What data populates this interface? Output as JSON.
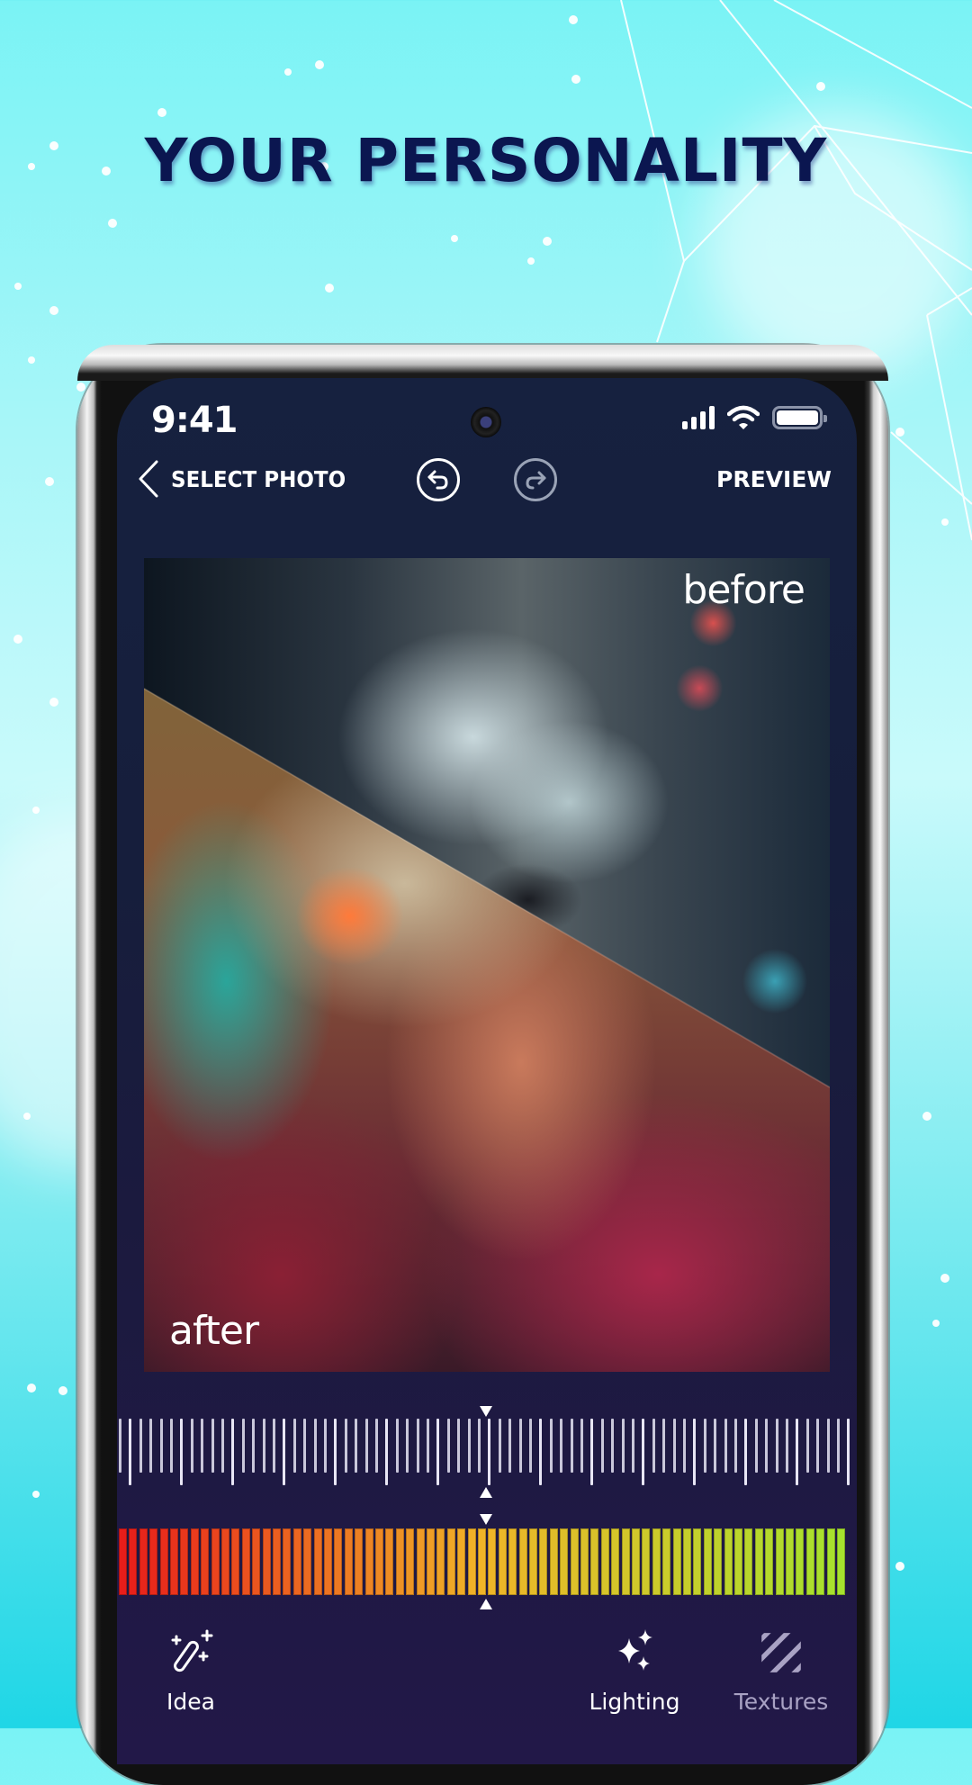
{
  "promo": {
    "headline": "YOUR PERSONALITY",
    "background_color": "#7af3f5",
    "headline_color": "#0b1650"
  },
  "status_bar": {
    "time": "9:41",
    "icons": [
      "signal-icon",
      "wifi-icon",
      "battery-icon"
    ]
  },
  "header": {
    "back_label": "SELECT PHOTO",
    "undo_icon": "undo-icon",
    "redo_icon": "redo-icon",
    "preview_label": "PREVIEW"
  },
  "photo": {
    "before_label": "before",
    "after_label": "after"
  },
  "adjustment": {
    "ruler_position": 0.5,
    "color_slider_position": 0.5,
    "color_scale": {
      "start": "#e81d1a",
      "middle": "#f0b428",
      "end": "#a6e22e"
    }
  },
  "toolbar": {
    "items": [
      {
        "label": "Idea",
        "icon": "magic-wand-icon",
        "active": true
      },
      {
        "label": "Lighting",
        "icon": "sparkles-icon",
        "active": true
      },
      {
        "label": "Textures",
        "icon": "texture-stripes-icon",
        "active": false
      }
    ]
  },
  "theme": {
    "screen_bg": "#16213f",
    "toolbar_bg": "#221848",
    "text": "#ffffff",
    "dim_text": "#a9a2c4"
  }
}
